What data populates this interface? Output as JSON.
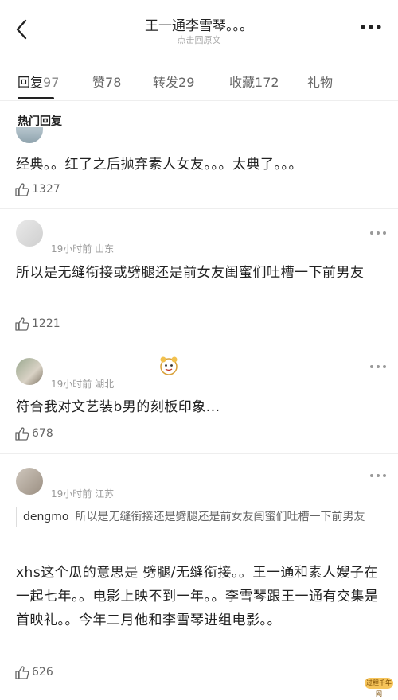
{
  "header": {
    "title": "王一通李雪琴。。。",
    "subtitle": "点击回原文"
  },
  "tabs": [
    {
      "label": "回复",
      "count": "97",
      "active": true
    },
    {
      "label": "赞",
      "count": "78"
    },
    {
      "label": "转发",
      "count": "29"
    },
    {
      "label": "收藏",
      "count": "172"
    },
    {
      "label": "礼物",
      "count": ""
    }
  ],
  "section_title": "热门回复",
  "comments": [
    {
      "meta": "",
      "text": "经典。。红了之后抛弃素人女友。。。太典了。。。",
      "likes": "1327"
    },
    {
      "meta": "19小时前 山东",
      "text": "所以是无缝衔接或劈腿还是前女友闺蜜们吐槽一下前男友",
      "likes": "1221"
    },
    {
      "meta": "19小时前 湖北",
      "text": "符合我对文艺装b男的刻板印象...",
      "likes": "678"
    },
    {
      "meta": "19小时前 江苏",
      "quote_name": "dengmo",
      "quote_text": "所以是无缝衔接还是劈腿还是前女友闺蜜们吐槽一下前男友",
      "text": "xhs这个瓜的意思是 劈腿/无缝衔接。。王一通和素人嫂子在一起七年。。电影上映不到一年。。李雪琴跟王一通有交集是首映礼。。今年二月他和李雪琴进组电影。。",
      "likes": "626"
    }
  ],
  "watermark": "过程千年网",
  "icons": [
    "back-arrow-icon",
    "more-dots-icon",
    "thumb-up-icon",
    "sticker-icon"
  ]
}
